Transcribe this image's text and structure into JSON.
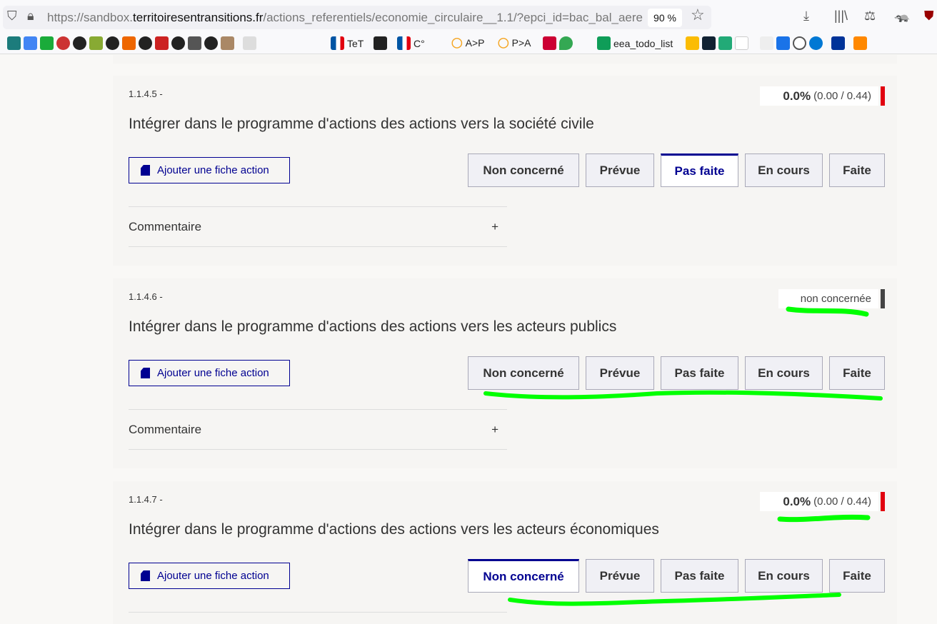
{
  "browser": {
    "url_prefix": "https://sandbox.",
    "url_domain": "territoiresentransitions.fr",
    "url_path": "/actions_referentiels/economie_circulaire__1.1/?epci_id=bac_bal_aere",
    "zoom": "90 %"
  },
  "bookmarks": [
    {
      "label": "TeT",
      "color": "#0055a4"
    },
    {
      "label": "C°",
      "color": "#0055a4"
    },
    {
      "label": "A>P",
      "color": "#f5a623"
    },
    {
      "label": "P>A",
      "color": "#f5a623"
    },
    {
      "label": "eea_todo_list",
      "color": "#0f9d58"
    }
  ],
  "colors": {
    "accent": "#000091",
    "red": "#e1000f",
    "grey": "#444444",
    "annotation": "#00ff00"
  },
  "actions": [
    {
      "code": "1.1.4.5 -",
      "title": "Intégrer dans le programme d'actions des actions vers la société civile",
      "score_pct": "0.0%",
      "score_detail": "(0.00 / 0.44)",
      "status_label": null,
      "selected": "Pas faite"
    },
    {
      "code": "1.1.4.6 -",
      "title": "Intégrer dans le programme d'actions des actions vers les acteurs publics",
      "score_pct": null,
      "score_detail": null,
      "status_label": "non concernée",
      "selected": null
    },
    {
      "code": "1.1.4.7 -",
      "title": "Intégrer dans le programme d'actions des actions vers les acteurs économiques",
      "score_pct": "0.0%",
      "score_detail": "(0.00 / 0.44)",
      "status_label": null,
      "selected": "Non concerné"
    }
  ],
  "labels": {
    "add_fiche": "Ajouter une fiche action",
    "comment": "Commentaire",
    "expand": "+"
  },
  "status_buttons": [
    "Non concerné",
    "Prévue",
    "Pas faite",
    "En cours",
    "Faite"
  ]
}
